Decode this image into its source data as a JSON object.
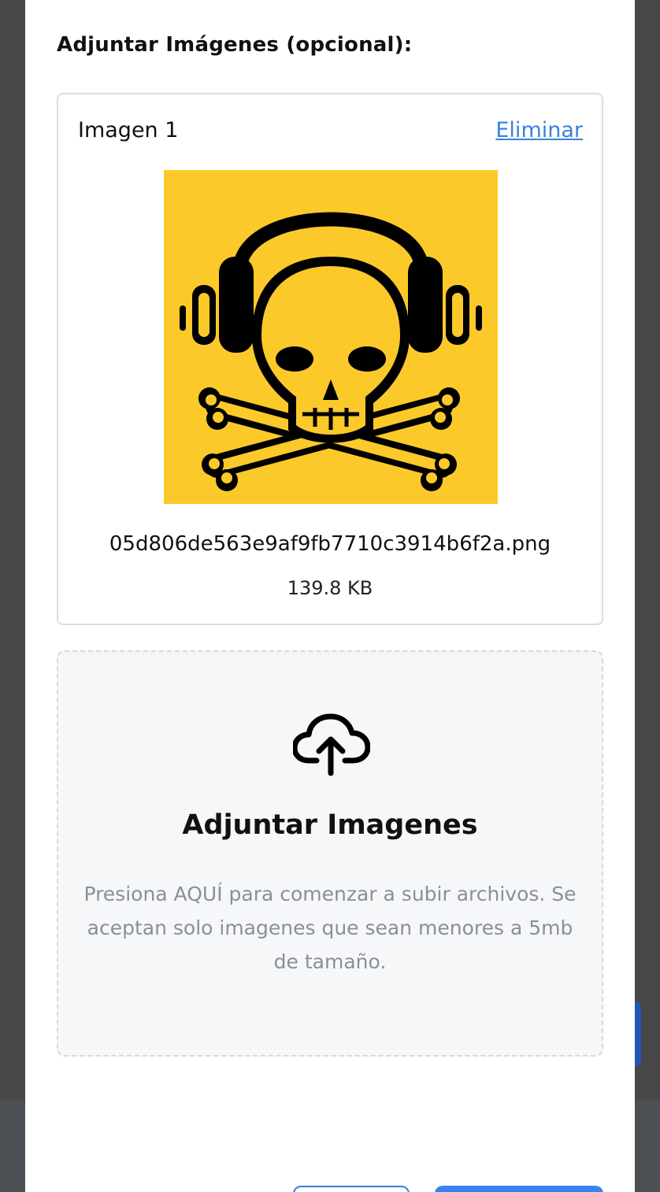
{
  "attachments": {
    "section_title": "Adjuntar Imágenes (opcional):",
    "images": [
      {
        "label": "Imagen 1",
        "remove_label": "Eliminar",
        "filename": "05d806de563e9af9fb7710c3914b6f2a.png",
        "size": "139.8 KB"
      }
    ]
  },
  "dropzone": {
    "icon": "cloud-upload-icon",
    "title": "Adjuntar Imagenes",
    "description": "Presiona AQUÍ para comenzar a subir archivos. Se aceptan solo imagenes que sean menores a 5mb de tamaño."
  },
  "colors": {
    "link": "#3b82e0",
    "primary": "#3b82f0",
    "thumbnail_bg": "#fcc92a",
    "backdrop": "#474747"
  }
}
